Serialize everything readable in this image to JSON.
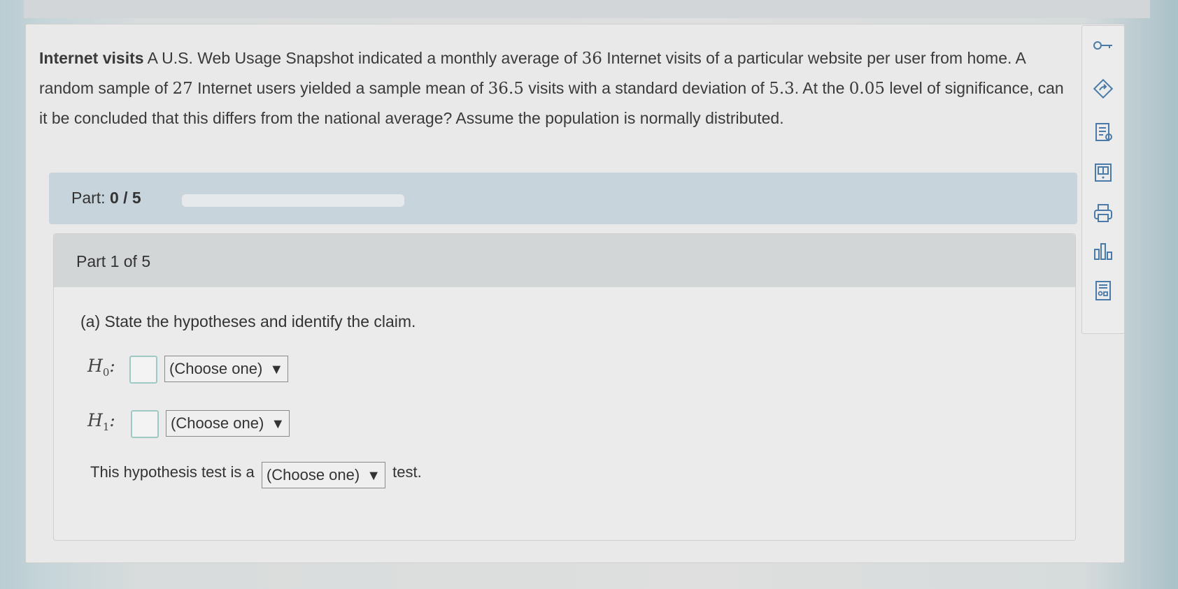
{
  "problem": {
    "title": "Internet visits",
    "text_1": " A U.S. Web Usage Snapshot indicated a monthly average of ",
    "num_1": "36",
    "text_2": " Internet visits of a particular website per user from home. A random sample of ",
    "num_2": "27",
    "text_3": " Internet users yielded a sample mean of ",
    "num_3": "36.5",
    "text_4": " visits with a standard deviation of ",
    "num_4": "5.3",
    "text_5": ". At the ",
    "num_5": "0.05",
    "text_6": " level of significance, can it be concluded that this differs from the national average? Assume the population is normally distributed."
  },
  "part_progress": {
    "label": "Part:",
    "value": "0 / 5",
    "fraction_complete": 0,
    "bar_color": "#5b8db8"
  },
  "part_panel": {
    "header": "Part 1 of 5",
    "question": "(a) State the hypotheses and identify the claim.",
    "h0": {
      "label": "H",
      "sub": "0",
      "colon": ":",
      "dropdown": "(Choose one)"
    },
    "h1": {
      "label": "H",
      "sub": "1",
      "colon": ":",
      "dropdown": "(Choose one)"
    },
    "test_sentence": {
      "before": "This hypothesis test is a",
      "dropdown": "(Choose one)",
      "after": "test."
    },
    "dropdown_arrow": "▼"
  },
  "toolbar": {
    "icons": [
      "key-icon",
      "arrow-diamond-icon",
      "notes-icon",
      "book-icon",
      "print-icon",
      "bar-chart-icon",
      "calculator-icon"
    ]
  }
}
